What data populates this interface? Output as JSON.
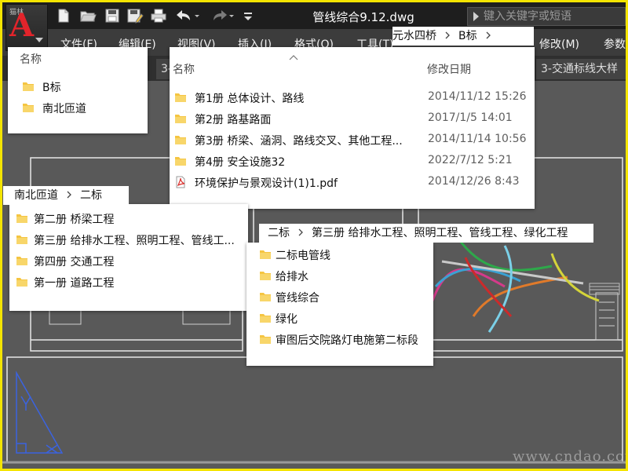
{
  "app": {
    "logo_caption": "猫林",
    "logo_letter": "A",
    "document_title": "管线综合9.12.dwg",
    "search_placeholder": "键入关键字或短语"
  },
  "menu": {
    "items": [
      "文件(F)",
      "编辑(E)",
      "视图(V)",
      "插入(I)",
      "格式(O)",
      "工具(T)",
      "修改(M)",
      "参数"
    ]
  },
  "tabs": {
    "left_label": "3-",
    "right_label": "3-交通标线大样"
  },
  "panel_top_left": {
    "header": "名称",
    "items": [
      "B标",
      "南北匝道"
    ]
  },
  "panel_main": {
    "breadcrumb": [
      "元水四桥",
      "B标"
    ],
    "col_name": "名称",
    "col_date": "修改日期",
    "items": [
      {
        "name": "第1册 总体设计、路线",
        "date": "2014/11/12 15:26",
        "type": "folder"
      },
      {
        "name": "第2册 路基路面",
        "date": "2017/1/5 14:01",
        "type": "folder"
      },
      {
        "name": "第3册 桥梁、涵洞、路线交叉、其他工程...",
        "date": "2014/11/14 10:56",
        "type": "folder"
      },
      {
        "name": "第4册 安全设施32",
        "date": "2022/7/12 5:21",
        "type": "folder"
      },
      {
        "name": "环境保护与景观设计(1)1.pdf",
        "date": "2014/12/26 8:43",
        "type": "pdf"
      }
    ]
  },
  "panel_mid_left": {
    "breadcrumb": [
      "南北匝道",
      "二标"
    ],
    "items": [
      "第二册 桥梁工程",
      "第三册 给排水工程、照明工程、管线工...",
      "第四册 交通工程",
      "第一册 道路工程"
    ]
  },
  "panel_center": {
    "breadcrumb": [
      "二标",
      "第三册 给排水工程、照明工程、管线工程、绿化工程"
    ],
    "items": [
      "二标电管线",
      "给排水",
      "管线综合",
      "绿化",
      "审图后交院路灯电施第二标段"
    ]
  },
  "watermark": "www.cndao.com",
  "colors": {
    "frame": "#f4e400",
    "titlebar": "#1e1e1e",
    "menubar": "#3c3c3c",
    "canvas": "#595959",
    "folder": "#f5c542",
    "logo_red": "#e2242b"
  }
}
